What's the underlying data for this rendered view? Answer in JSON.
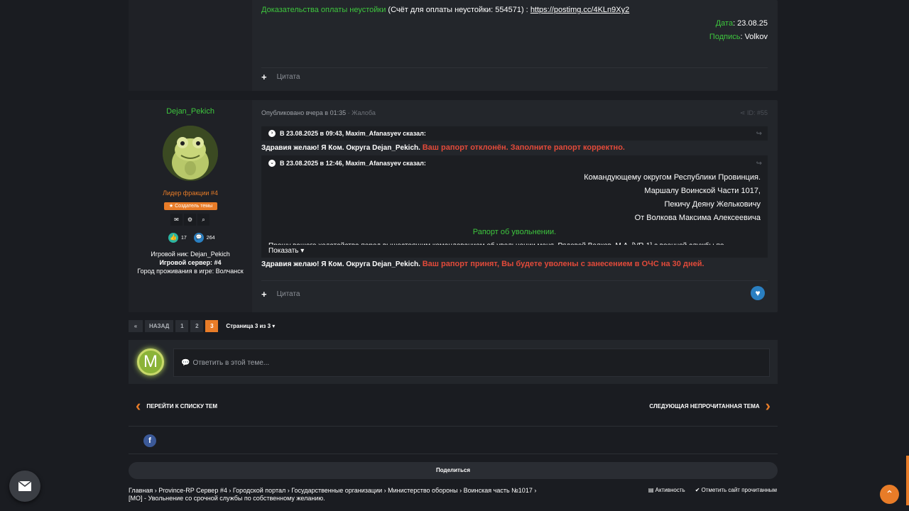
{
  "post1": {
    "proof_label": "Доказательства оплаты неустойки",
    "proof_invoice": "(Счёт для оплаты неустойки: 554571) :",
    "proof_link": "https://postimg.cc/4KLn9Xy2",
    "date_label": "Дата",
    "date_value": ": 23.08.25",
    "sign_label": "Подпись",
    "sign_value": ": Volkov",
    "quote_btn": "Цитата"
  },
  "post2": {
    "author": "Dejan_Pekich",
    "rank": "Лидер фракции #4",
    "badge": "Создатель темы",
    "reactions_likes": "17",
    "reactions_comments": "264",
    "game_nick": "Игровой ник: Dejan_Pekich",
    "game_server": "Игровой сервер: #4",
    "game_city": "Город проживания в игре: Волчанск",
    "published": "Опубликовано вчера в 01:35",
    "complaint": "· Жалоба",
    "post_id": "ID: #55",
    "quote1_head": "В 23.08.2025 в 09:43, Maxim_Afanasyev сказал:",
    "line1_white": "Здравия желаю! Я Ком. Округа Dejan_Pekich.",
    "line1_red": "Ваш рапорт отклонён. Заполните рапорт корректно.",
    "quote2_head": "В 23.08.2025 в 12:46, Maxim_Afanasyev сказал:",
    "q2_l1": "Командующему округом Республики Провинция.",
    "q2_l2": "Маршалу Воинской Части 1017,",
    "q2_l3": "Пекичу Деяну Желькoвичу",
    "q2_l4": "От Волкова Максима Алексеевича",
    "q2_title": "Рапорт об увольнении.",
    "q2_cut": "Прошу вашего ходатайства перед вышестоящим командованием об увольнении меня, Рядовой Волков. М.А. [VR-1] с военной службы по",
    "q2_show": "Показать",
    "line2_white": "Здравия желаю! Я Ком. Округа Dejan_Pekich.",
    "line2_red": "Ваш рапорт принят, Вы будете уволены с занесением в ОЧС на 30 дней.",
    "quote_btn": "Цитата"
  },
  "pagination": {
    "back": "НАЗАД",
    "pages": [
      "1",
      "2",
      "3"
    ],
    "current": "3",
    "summary": "Страница 3 из 3"
  },
  "reply": {
    "avatar_letter": "M",
    "placeholder": "Ответить в этой теме..."
  },
  "nav": {
    "prev": "ПЕРЕЙТИ К СПИСКУ ТЕМ",
    "next": "СЛЕДУЮЩАЯ НЕПРОЧИТАННАЯ ТЕМА"
  },
  "share": {
    "label": "Поделиться"
  },
  "breadcrumb": {
    "items": [
      "Главная",
      "Province-RP Сервер #4",
      "Городской портал",
      "Государственные организации",
      "Министерство обороны",
      "Воинская часть №1017"
    ],
    "current": "[МО] - Увольнение со срочной службы по собственному желанию."
  },
  "footer_links": {
    "activity": "Активность",
    "mark_read": "Отметить сайт прочитанным"
  },
  "colors": {
    "accent": "#e87c28",
    "green": "#3ec63e",
    "red": "#e24a3a"
  }
}
